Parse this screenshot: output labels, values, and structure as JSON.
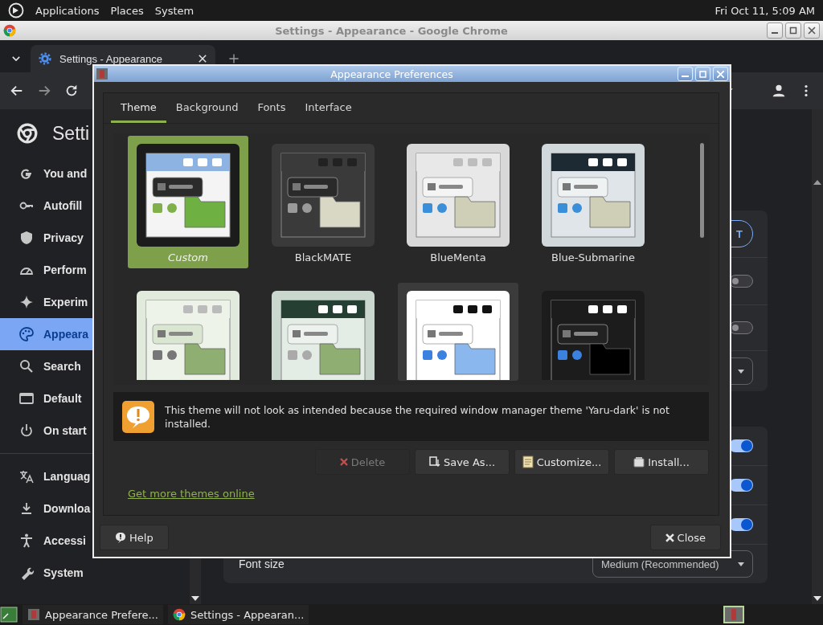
{
  "top_panel": {
    "menus": [
      {
        "label": "Applications"
      },
      {
        "label": "Places"
      },
      {
        "label": "System"
      }
    ],
    "clock": "Fri Oct 11, 5:09 AM"
  },
  "browser": {
    "title": "Settings - Appearance - Google Chrome",
    "tab": {
      "title": "Settings - Appearance"
    },
    "page_title": "Setti",
    "nav": [
      {
        "label": "You and",
        "selected": false
      },
      {
        "label": "Autofill",
        "selected": false
      },
      {
        "label": "Privacy",
        "selected": false
      },
      {
        "label": "Perform",
        "selected": false
      },
      {
        "label": "Experim",
        "selected": false
      },
      {
        "label": "Appeara",
        "selected": true
      },
      {
        "label": "Search",
        "selected": false
      },
      {
        "label": "Default",
        "selected": false
      },
      {
        "label": "On start",
        "selected": false
      }
    ],
    "nav_more": [
      {
        "label": "Languag",
        "selected": false
      },
      {
        "label": "Downloa",
        "selected": false
      },
      {
        "label": "Accessi",
        "selected": false
      },
      {
        "label": "System",
        "selected": false
      }
    ],
    "cards": [
      {
        "rows": [
          {
            "kind": "button",
            "label": "T"
          },
          {
            "kind": "toggle",
            "on": false
          },
          {
            "kind": "toggle",
            "on": false
          },
          {
            "kind": "dropdown"
          }
        ]
      },
      {
        "rows": [
          {
            "kind": "toggle",
            "on": true
          },
          {
            "kind": "toggle",
            "on": true
          },
          {
            "kind": "toggle",
            "on": true
          },
          {
            "kind": "dropdown",
            "label": "Font size",
            "value": "Medium (Recommended)"
          }
        ]
      }
    ]
  },
  "dialog": {
    "title": "Appearance Preferences",
    "tabs": [
      {
        "label": "Theme",
        "selected": true
      },
      {
        "label": "Background",
        "selected": false
      },
      {
        "label": "Fonts",
        "selected": false
      },
      {
        "label": "Interface",
        "selected": false
      }
    ],
    "themes": [
      {
        "label": "Custom",
        "selected": true,
        "hovered": false
      },
      {
        "label": "BlackMATE",
        "selected": false,
        "hovered": false
      },
      {
        "label": "BlueMenta",
        "selected": false,
        "hovered": false
      },
      {
        "label": "Blue-Submarine",
        "selected": false,
        "hovered": false
      },
      {
        "selected": false,
        "hovered": false
      },
      {
        "selected": false,
        "hovered": false
      },
      {
        "selected": false,
        "hovered": true
      },
      {
        "selected": false,
        "hovered": false
      }
    ],
    "message": "This theme will not look as intended because the required window manager theme 'Yaru-dark' is not installed.",
    "actions": [
      {
        "label": "Delete",
        "disabled": true
      },
      {
        "label": "Save As...",
        "disabled": false
      },
      {
        "label": "Customize...",
        "disabled": false
      },
      {
        "label": "Install...",
        "disabled": false
      }
    ],
    "link": "Get more themes online",
    "help": "Help",
    "close": "Close"
  },
  "taskbar": {
    "tasks": [
      {
        "label": "Appearance Prefere..."
      },
      {
        "label": "Settings - Appearan..."
      }
    ]
  }
}
